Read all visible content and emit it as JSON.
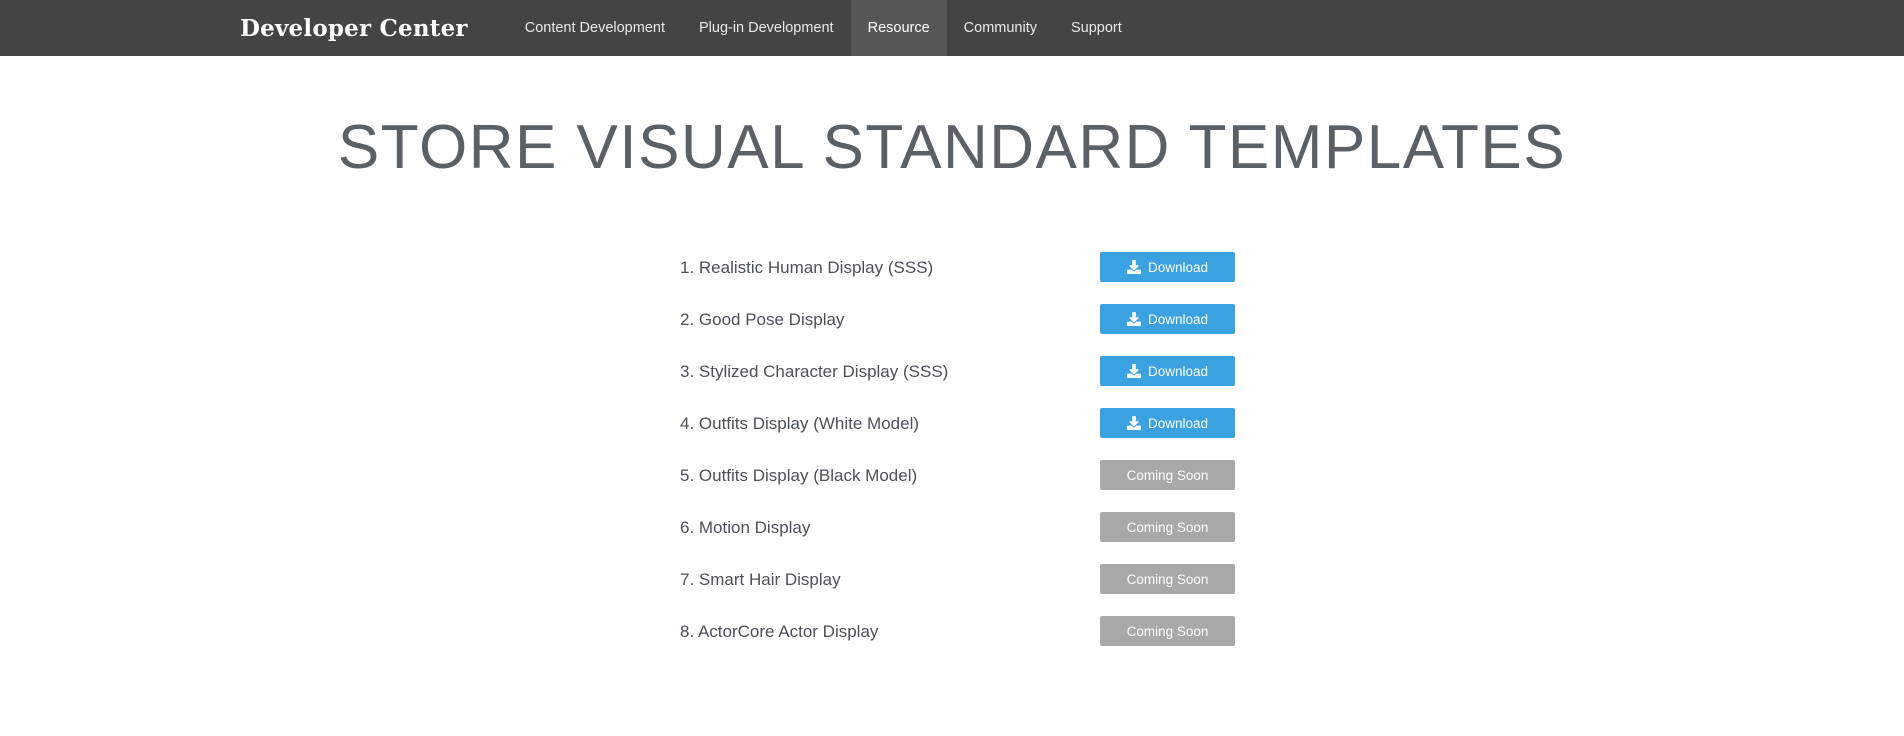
{
  "header": {
    "brand": "Developer Center",
    "nav_items": [
      {
        "label": "Content Development",
        "active": false
      },
      {
        "label": "Plug-in Development",
        "active": false
      },
      {
        "label": "Resource",
        "active": true
      },
      {
        "label": "Community",
        "active": false
      },
      {
        "label": "Support",
        "active": false
      }
    ],
    "background_color": "#444444",
    "active_color": "#565656"
  },
  "main": {
    "page_title": "STORE VISUAL STANDARD TEMPLATES",
    "title_color": "#5a6066",
    "templates": [
      {
        "label": "1. Realistic Human Display (SSS)",
        "action": "Download",
        "state": "available",
        "icon": "download-icon"
      },
      {
        "label": "2. Good Pose Display",
        "action": "Download",
        "state": "available",
        "icon": "download-icon"
      },
      {
        "label": "3. Stylized Character Display (SSS)",
        "action": "Download",
        "state": "available",
        "icon": "download-icon"
      },
      {
        "label": "4. Outfits Display (White Model)",
        "action": "Download",
        "state": "available",
        "icon": "download-icon"
      },
      {
        "label": "5. Outfits Display (Black Model)",
        "action": "Coming Soon",
        "state": "coming_soon",
        "icon": ""
      },
      {
        "label": "6. Motion Display",
        "action": "Coming Soon",
        "state": "coming_soon",
        "icon": ""
      },
      {
        "label": "7. Smart Hair Display",
        "action": "Coming Soon",
        "state": "coming_soon",
        "icon": ""
      },
      {
        "label": "8. ActorCore Actor Display",
        "action": "Coming Soon",
        "state": "coming_soon",
        "icon": ""
      }
    ],
    "download_button_color": "#3aa2e0",
    "coming_soon_button_color": "#a8a8a8"
  }
}
